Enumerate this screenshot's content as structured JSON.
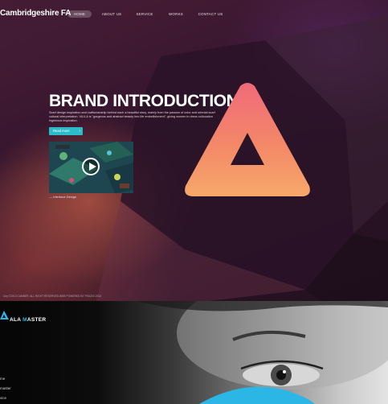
{
  "logo": "Cambridgeshire FA",
  "nav": {
    "items": [
      "HOME",
      "ABOUT US",
      "SERVICE",
      "WORKS",
      "CONTACT US"
    ],
    "active_index": 0
  },
  "hero": {
    "headline": "BRAND INTRODUCTION",
    "description": "Scarf design inspiration and craftsmanship behind each a beautiful story, mainly from the passion of color and oriental scarf cultural interpretation. VILILA is \"gorgeous and abstract beauty into life embellishment\", giving women in dress collocation ingenious inspiration.",
    "read_more": "Read more",
    "read_more_arrow": "›",
    "video_caption": "— Interface Design",
    "accent_color": "#2bbbc9"
  },
  "footer": {
    "copyright": "Coy ©2013 CAMBER. ALL RIGHT RESERVED.WEB POWERED BY PSICED 2013"
  },
  "lower": {
    "brand_prefix": "ALA ",
    "brand_accent_letter": "M",
    "brand_suffix": "ASTER",
    "menu": [
      "me",
      "master",
      "vice"
    ],
    "accent_color": "#2bb6e6"
  }
}
